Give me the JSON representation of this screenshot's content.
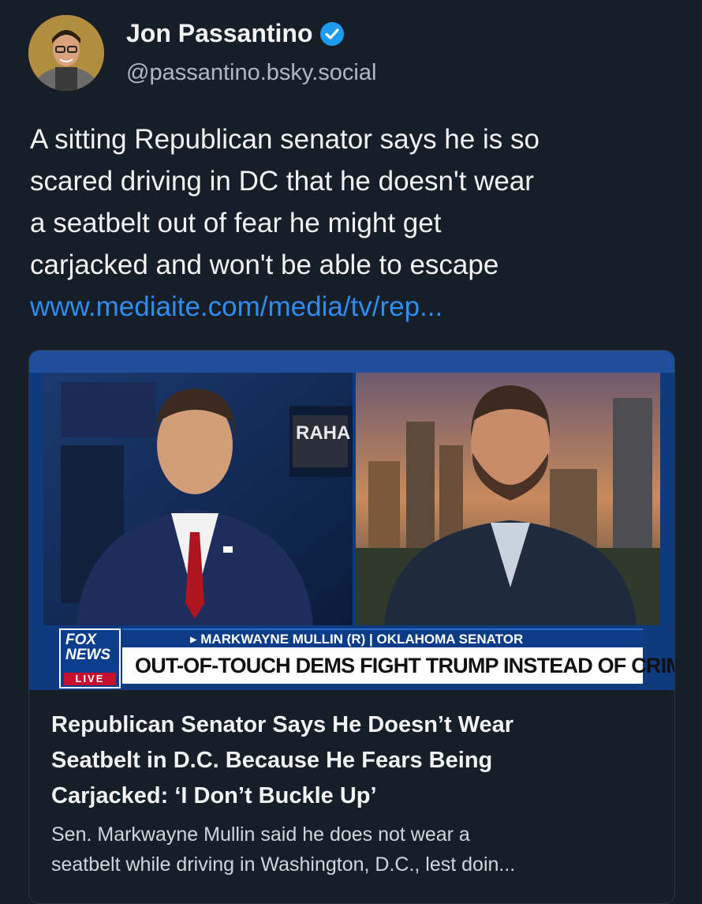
{
  "post": {
    "display_name": "Jon Passantino",
    "handle": "@passantino.bsky.social",
    "verified_icon": "verified-check-icon",
    "verified_color": "#1d9bf0",
    "text_lines": [
      "A sitting Republican senator says he is so",
      "scared driving in DC that he doesn't wear",
      "a seatbelt out of fear he might get",
      "carjacked and won't be able to escape"
    ],
    "link_text": "www.mediaite.com/media/tv/rep..."
  },
  "card": {
    "image": {
      "chyron_top": "▸ MARKWAYNE MULLIN (R) | OKLAHOMA SENATOR",
      "chyron_main": "OUT-OF-TOUCH DEMS FIGHT TRUMP INSTEAD OF CRIME",
      "logo_text_1": "FOX",
      "logo_text_2": "NEWS",
      "logo_live": "LIVE",
      "studio_sign": "RAHA"
    },
    "title_lines": [
      "Republican Senator Says He Doesn’t Wear",
      "Seatbelt in D.C. Because He Fears Being",
      "Carjacked: ‘I Don’t Buckle Up’"
    ],
    "description_lines": [
      "Sen. Markwayne Mullin said he does not wear a",
      "seatbelt while driving in Washington, D.C., lest doin..."
    ]
  },
  "colors": {
    "background": "#161e27",
    "link": "#2f8cf0",
    "fox_blue": "#0b3f8e",
    "live_red": "#c8102e"
  }
}
